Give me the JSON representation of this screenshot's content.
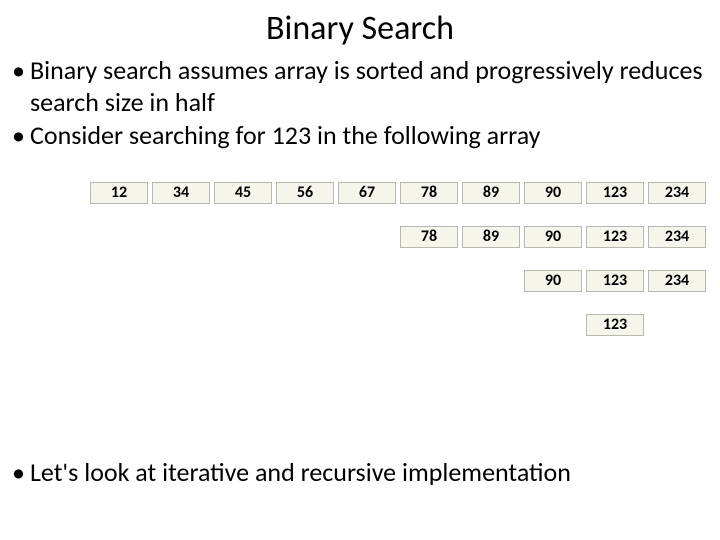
{
  "title": "Binary Search",
  "bullets": [
    "Binary search assumes array is sorted and progressively reduces search size in half",
    "Consider searching for 123 in the following array"
  ],
  "footer": "Let's look at iterative and recursive implementation",
  "rows": [
    {
      "offset": 0,
      "cells": [
        "12",
        "34",
        "45",
        "56",
        "67",
        "78",
        "89",
        "90",
        "123",
        "234"
      ]
    },
    {
      "offset": 5,
      "cells": [
        "78",
        "89",
        "90",
        "123",
        "234"
      ]
    },
    {
      "offset": 7,
      "cells": [
        "90",
        "123",
        "234"
      ]
    },
    {
      "offset": 8,
      "cells": [
        "123"
      ]
    }
  ]
}
